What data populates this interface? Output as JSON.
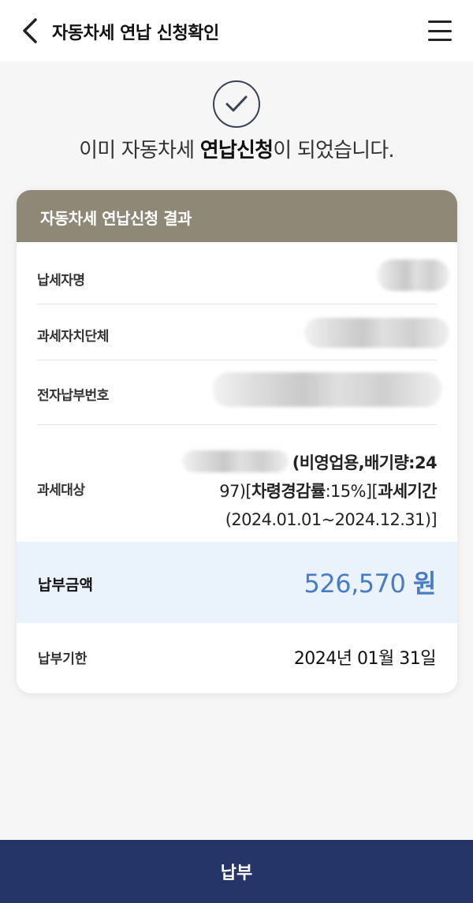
{
  "header": {
    "title": "자동차세 연납 신청확인",
    "back_icon": "chevron-left-icon",
    "menu_icon": "hamburger-menu-icon"
  },
  "status": {
    "icon": "check-circle-icon",
    "prefix": "이미 자동차세 ",
    "emphasis": "연납신청",
    "suffix": "이 되었습니다."
  },
  "result_card": {
    "title": "자동차세 연납신청 결과",
    "header_color": "#8f8876",
    "rows": {
      "taxpayer_label": "납세자명",
      "authority_label": "과세자치단체",
      "payment_no_label": "전자납부번호",
      "target_label": "과세대상"
    },
    "target": {
      "part1": "(비영업용,배기량:24",
      "part2": "97)[",
      "part3": "차령경감률",
      "part4": ":15%][",
      "part5": "과세기간",
      "part6": "(2024.01.01~2024.12.31)]"
    },
    "amount": {
      "label": "납부금액",
      "value": "526,570",
      "unit": "원",
      "color": "#4a7cc4"
    },
    "due": {
      "label": "납부기한",
      "value": "2024년 01월 31일"
    }
  },
  "footer": {
    "pay_button": "납부",
    "button_color": "#253565"
  }
}
